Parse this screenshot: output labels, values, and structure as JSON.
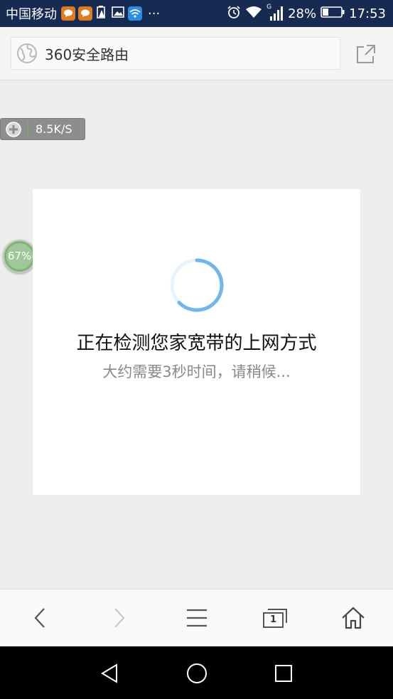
{
  "status_bar": {
    "carrier": "中国移动",
    "more": "···",
    "battery_percent": "28%",
    "time": "17:53",
    "network_type": "G"
  },
  "address_bar": {
    "url_text": "360安全路由"
  },
  "floating": {
    "speed": "8.5K/S",
    "progress_percent": "67%",
    "progress_value": 0.67
  },
  "loading_card": {
    "title": "正在检测您家宽带的上网方式",
    "subtitle": "大约需要3秒时间，请稍候..."
  },
  "toolbar": {
    "tab_count": "1"
  },
  "colors": {
    "status_bar_bg": "#172a52",
    "speed_accent": "#7ab84f",
    "spinner": "#6fb6ec"
  }
}
